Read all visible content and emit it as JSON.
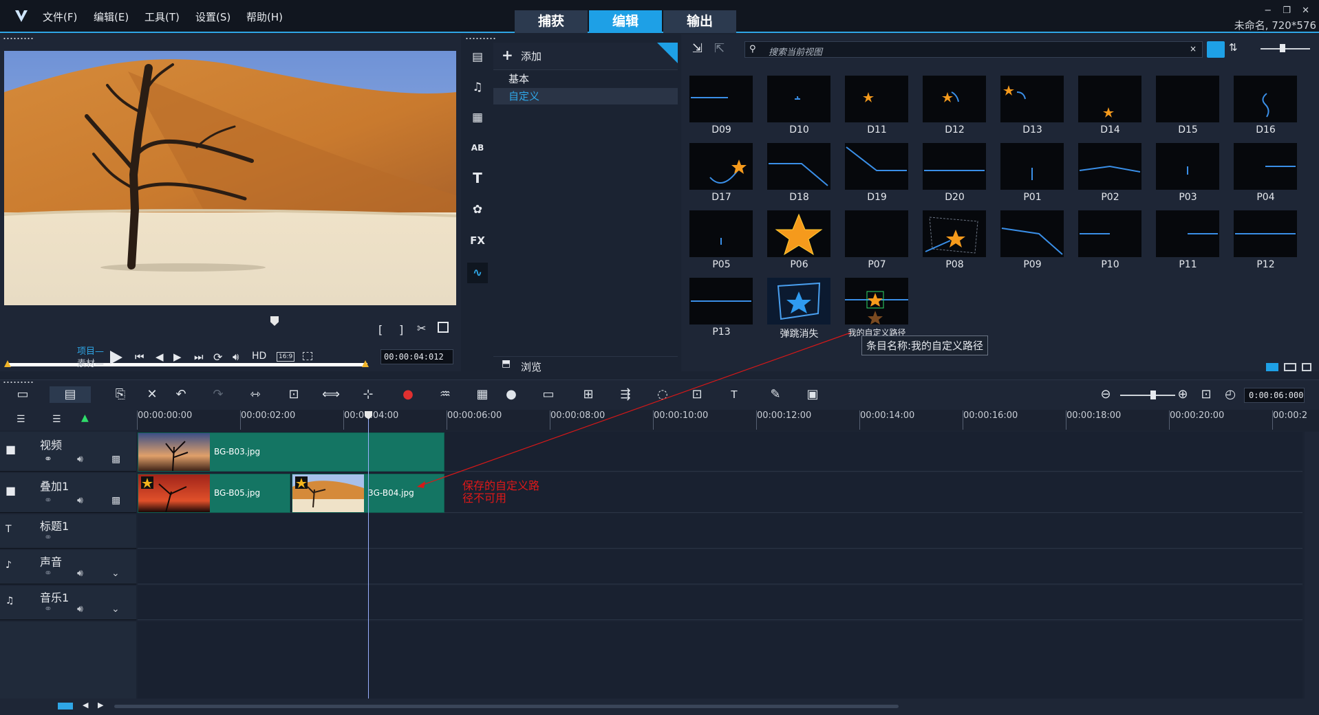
{
  "menu": [
    "文件(F)",
    "编辑(E)",
    "工具(T)",
    "设置(S)",
    "帮助(H)"
  ],
  "modes": [
    "捕获",
    "编辑",
    "输出"
  ],
  "active_mode": "编辑",
  "window_controls": [
    "−",
    "❐",
    "✕"
  ],
  "project_info": "未命名, 720*576",
  "preview": {
    "project_label": "项目",
    "clip_label": "素材",
    "hd_label": "HD",
    "aspect_label": "16:9",
    "timecode": "00:00:04:012"
  },
  "options": {
    "add_label": "添加",
    "categories": [
      "基本",
      "自定义"
    ],
    "selected_category": "自定义",
    "browse_label": "浏览"
  },
  "library": {
    "search_placeholder": "搜索当前视图",
    "tooltip": "条目名称:我的自定义路径",
    "items": [
      "D09",
      "D10",
      "D11",
      "D12",
      "D13",
      "D14",
      "D15",
      "D16",
      "D17",
      "D18",
      "D19",
      "D20",
      "P01",
      "P02",
      "P03",
      "P04",
      "P05",
      "P06",
      "P07",
      "P08",
      "P09",
      "P10",
      "P11",
      "P12",
      "P13",
      "弹跳消失",
      "我的自定义路径"
    ]
  },
  "timeline": {
    "total_duration": "0:00:06:000",
    "ruler": [
      "00:00:00:00",
      "00:00:02:00",
      "00:00:04:00",
      "00:00:06:00",
      "00:00:08:00",
      "00:00:10:00",
      "00:00:12:00",
      "00:00:14:00",
      "00:00:16:00",
      "00:00:18:00",
      "00:00:20:00",
      "00:00:2"
    ],
    "tracks": [
      "视频",
      "叠加1",
      "标题1",
      "声音",
      "音乐1"
    ],
    "clips": {
      "video": "BG-B03.jpg",
      "overlay1": "BG-B05.jpg",
      "overlay2": "3G-B04.jpg"
    }
  },
  "annotation": {
    "line1": "保存的自定义路",
    "line2": "径不可用",
    "color": "#e01818"
  },
  "accent_color": "#1ea0e6"
}
